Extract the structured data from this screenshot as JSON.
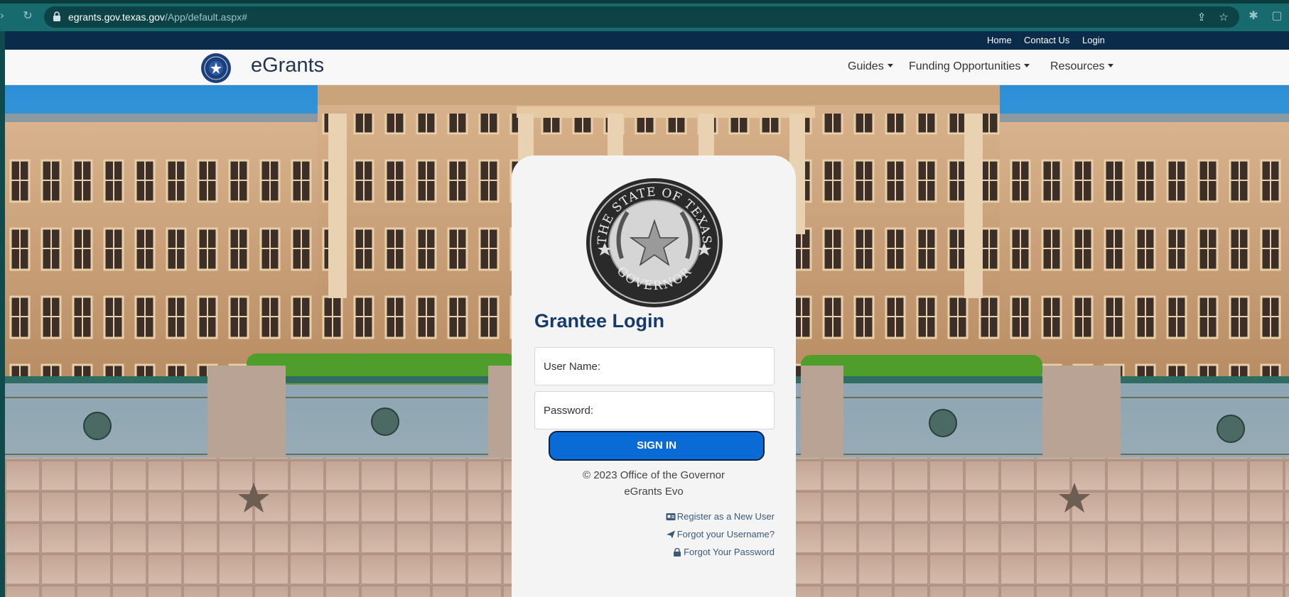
{
  "browser": {
    "url_host": "egrants.gov.texas.gov",
    "url_path": "/App/default.aspx#"
  },
  "topnav": {
    "home": "Home",
    "contact": "Contact Us",
    "login": "Login"
  },
  "brand": {
    "name": "eGrants"
  },
  "menu": {
    "guides": "Guides",
    "funding": "Funding Opportunities",
    "resources": "Resources"
  },
  "login": {
    "seal_text_top": "THE STATE OF TEXAS",
    "seal_text_bottom": "GOVERNOR",
    "title": "Grantee Login",
    "username_placeholder": "User Name:",
    "password_placeholder": "Password:",
    "signin_label": "SIGN IN",
    "copyright": "© 2023 Office of the Governor",
    "product": "eGrants Evo",
    "register": "Register as a New User",
    "forgot_username": "Forgot your Username?",
    "forgot_password": "Forgot Your Password"
  },
  "icons": [
    "reload-icon",
    "lock-icon",
    "share-icon",
    "star-icon",
    "extension-icon",
    "sidepanel-icon",
    "id-card-icon",
    "paper-plane-icon",
    "padlock-icon"
  ],
  "colors": {
    "browser": "#176a6e",
    "topnav": "#0a2b4a",
    "title": "#163a6b",
    "signin": "#0a6ad6"
  }
}
